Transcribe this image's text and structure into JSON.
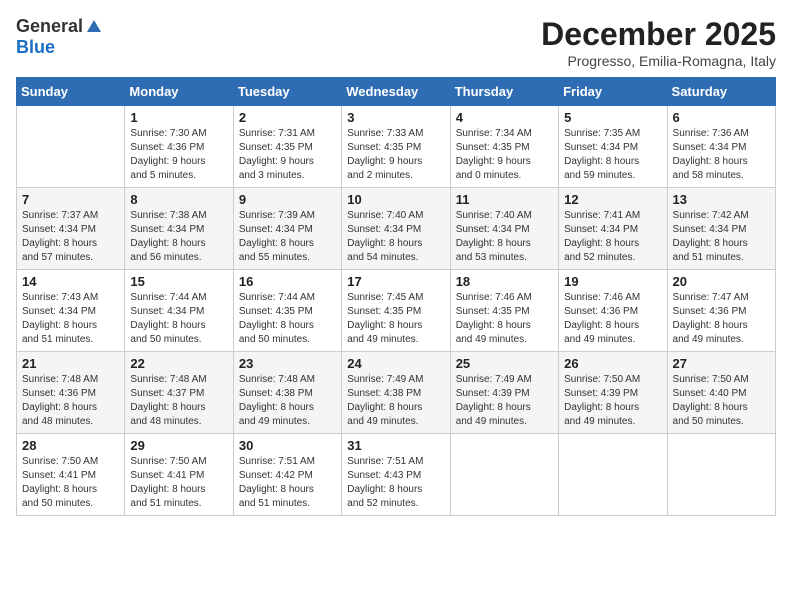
{
  "logo": {
    "general": "General",
    "blue": "Blue"
  },
  "title": "December 2025",
  "subtitle": "Progresso, Emilia-Romagna, Italy",
  "weekdays": [
    "Sunday",
    "Monday",
    "Tuesday",
    "Wednesday",
    "Thursday",
    "Friday",
    "Saturday"
  ],
  "weeks": [
    [
      {
        "day": "",
        "info": ""
      },
      {
        "day": "1",
        "info": "Sunrise: 7:30 AM\nSunset: 4:36 PM\nDaylight: 9 hours\nand 5 minutes."
      },
      {
        "day": "2",
        "info": "Sunrise: 7:31 AM\nSunset: 4:35 PM\nDaylight: 9 hours\nand 3 minutes."
      },
      {
        "day": "3",
        "info": "Sunrise: 7:33 AM\nSunset: 4:35 PM\nDaylight: 9 hours\nand 2 minutes."
      },
      {
        "day": "4",
        "info": "Sunrise: 7:34 AM\nSunset: 4:35 PM\nDaylight: 9 hours\nand 0 minutes."
      },
      {
        "day": "5",
        "info": "Sunrise: 7:35 AM\nSunset: 4:34 PM\nDaylight: 8 hours\nand 59 minutes."
      },
      {
        "day": "6",
        "info": "Sunrise: 7:36 AM\nSunset: 4:34 PM\nDaylight: 8 hours\nand 58 minutes."
      }
    ],
    [
      {
        "day": "7",
        "info": "Sunrise: 7:37 AM\nSunset: 4:34 PM\nDaylight: 8 hours\nand 57 minutes."
      },
      {
        "day": "8",
        "info": "Sunrise: 7:38 AM\nSunset: 4:34 PM\nDaylight: 8 hours\nand 56 minutes."
      },
      {
        "day": "9",
        "info": "Sunrise: 7:39 AM\nSunset: 4:34 PM\nDaylight: 8 hours\nand 55 minutes."
      },
      {
        "day": "10",
        "info": "Sunrise: 7:40 AM\nSunset: 4:34 PM\nDaylight: 8 hours\nand 54 minutes."
      },
      {
        "day": "11",
        "info": "Sunrise: 7:40 AM\nSunset: 4:34 PM\nDaylight: 8 hours\nand 53 minutes."
      },
      {
        "day": "12",
        "info": "Sunrise: 7:41 AM\nSunset: 4:34 PM\nDaylight: 8 hours\nand 52 minutes."
      },
      {
        "day": "13",
        "info": "Sunrise: 7:42 AM\nSunset: 4:34 PM\nDaylight: 8 hours\nand 51 minutes."
      }
    ],
    [
      {
        "day": "14",
        "info": "Sunrise: 7:43 AM\nSunset: 4:34 PM\nDaylight: 8 hours\nand 51 minutes."
      },
      {
        "day": "15",
        "info": "Sunrise: 7:44 AM\nSunset: 4:34 PM\nDaylight: 8 hours\nand 50 minutes."
      },
      {
        "day": "16",
        "info": "Sunrise: 7:44 AM\nSunset: 4:35 PM\nDaylight: 8 hours\nand 50 minutes."
      },
      {
        "day": "17",
        "info": "Sunrise: 7:45 AM\nSunset: 4:35 PM\nDaylight: 8 hours\nand 49 minutes."
      },
      {
        "day": "18",
        "info": "Sunrise: 7:46 AM\nSunset: 4:35 PM\nDaylight: 8 hours\nand 49 minutes."
      },
      {
        "day": "19",
        "info": "Sunrise: 7:46 AM\nSunset: 4:36 PM\nDaylight: 8 hours\nand 49 minutes."
      },
      {
        "day": "20",
        "info": "Sunrise: 7:47 AM\nSunset: 4:36 PM\nDaylight: 8 hours\nand 49 minutes."
      }
    ],
    [
      {
        "day": "21",
        "info": "Sunrise: 7:48 AM\nSunset: 4:36 PM\nDaylight: 8 hours\nand 48 minutes."
      },
      {
        "day": "22",
        "info": "Sunrise: 7:48 AM\nSunset: 4:37 PM\nDaylight: 8 hours\nand 48 minutes."
      },
      {
        "day": "23",
        "info": "Sunrise: 7:48 AM\nSunset: 4:38 PM\nDaylight: 8 hours\nand 49 minutes."
      },
      {
        "day": "24",
        "info": "Sunrise: 7:49 AM\nSunset: 4:38 PM\nDaylight: 8 hours\nand 49 minutes."
      },
      {
        "day": "25",
        "info": "Sunrise: 7:49 AM\nSunset: 4:39 PM\nDaylight: 8 hours\nand 49 minutes."
      },
      {
        "day": "26",
        "info": "Sunrise: 7:50 AM\nSunset: 4:39 PM\nDaylight: 8 hours\nand 49 minutes."
      },
      {
        "day": "27",
        "info": "Sunrise: 7:50 AM\nSunset: 4:40 PM\nDaylight: 8 hours\nand 50 minutes."
      }
    ],
    [
      {
        "day": "28",
        "info": "Sunrise: 7:50 AM\nSunset: 4:41 PM\nDaylight: 8 hours\nand 50 minutes."
      },
      {
        "day": "29",
        "info": "Sunrise: 7:50 AM\nSunset: 4:41 PM\nDaylight: 8 hours\nand 51 minutes."
      },
      {
        "day": "30",
        "info": "Sunrise: 7:51 AM\nSunset: 4:42 PM\nDaylight: 8 hours\nand 51 minutes."
      },
      {
        "day": "31",
        "info": "Sunrise: 7:51 AM\nSunset: 4:43 PM\nDaylight: 8 hours\nand 52 minutes."
      },
      {
        "day": "",
        "info": ""
      },
      {
        "day": "",
        "info": ""
      },
      {
        "day": "",
        "info": ""
      }
    ]
  ]
}
